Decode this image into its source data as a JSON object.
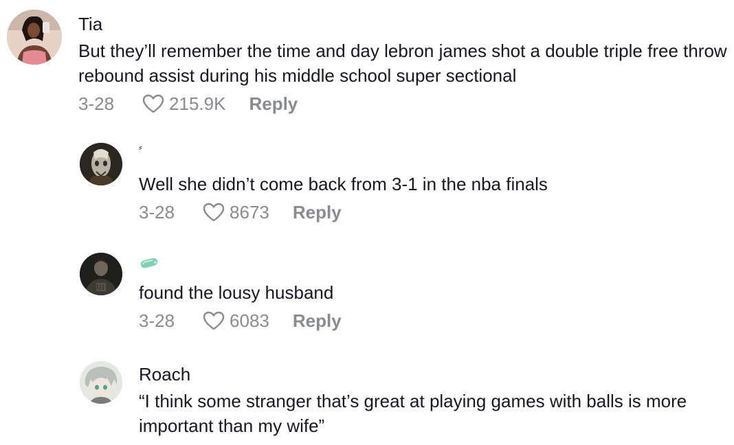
{
  "comments": [
    {
      "username": "Tia",
      "text": "But they’ll remember the time and day lebron james shot a double triple free throw rebound assist during his middle school super sectional",
      "date": "3-28",
      "likes": "215.9K",
      "reply_label": "Reply"
    },
    {
      "username": "⸗",
      "text": "Well she didn’t come back from 3-1 in the nba finals",
      "date": "3-28",
      "likes": "8673",
      "reply_label": "Reply"
    },
    {
      "username": "",
      "username_icon": "soap-icon",
      "text": "found the lousy husband",
      "date": "3-28",
      "likes": "6083",
      "reply_label": "Reply"
    },
    {
      "username": "Roach",
      "text": "“I think some stranger that’s great at playing games with balls is more important than my wife”"
    }
  ],
  "colors": {
    "text": "#161823",
    "meta": "#8a8b91",
    "soap_icon": "#7fd3b0"
  }
}
